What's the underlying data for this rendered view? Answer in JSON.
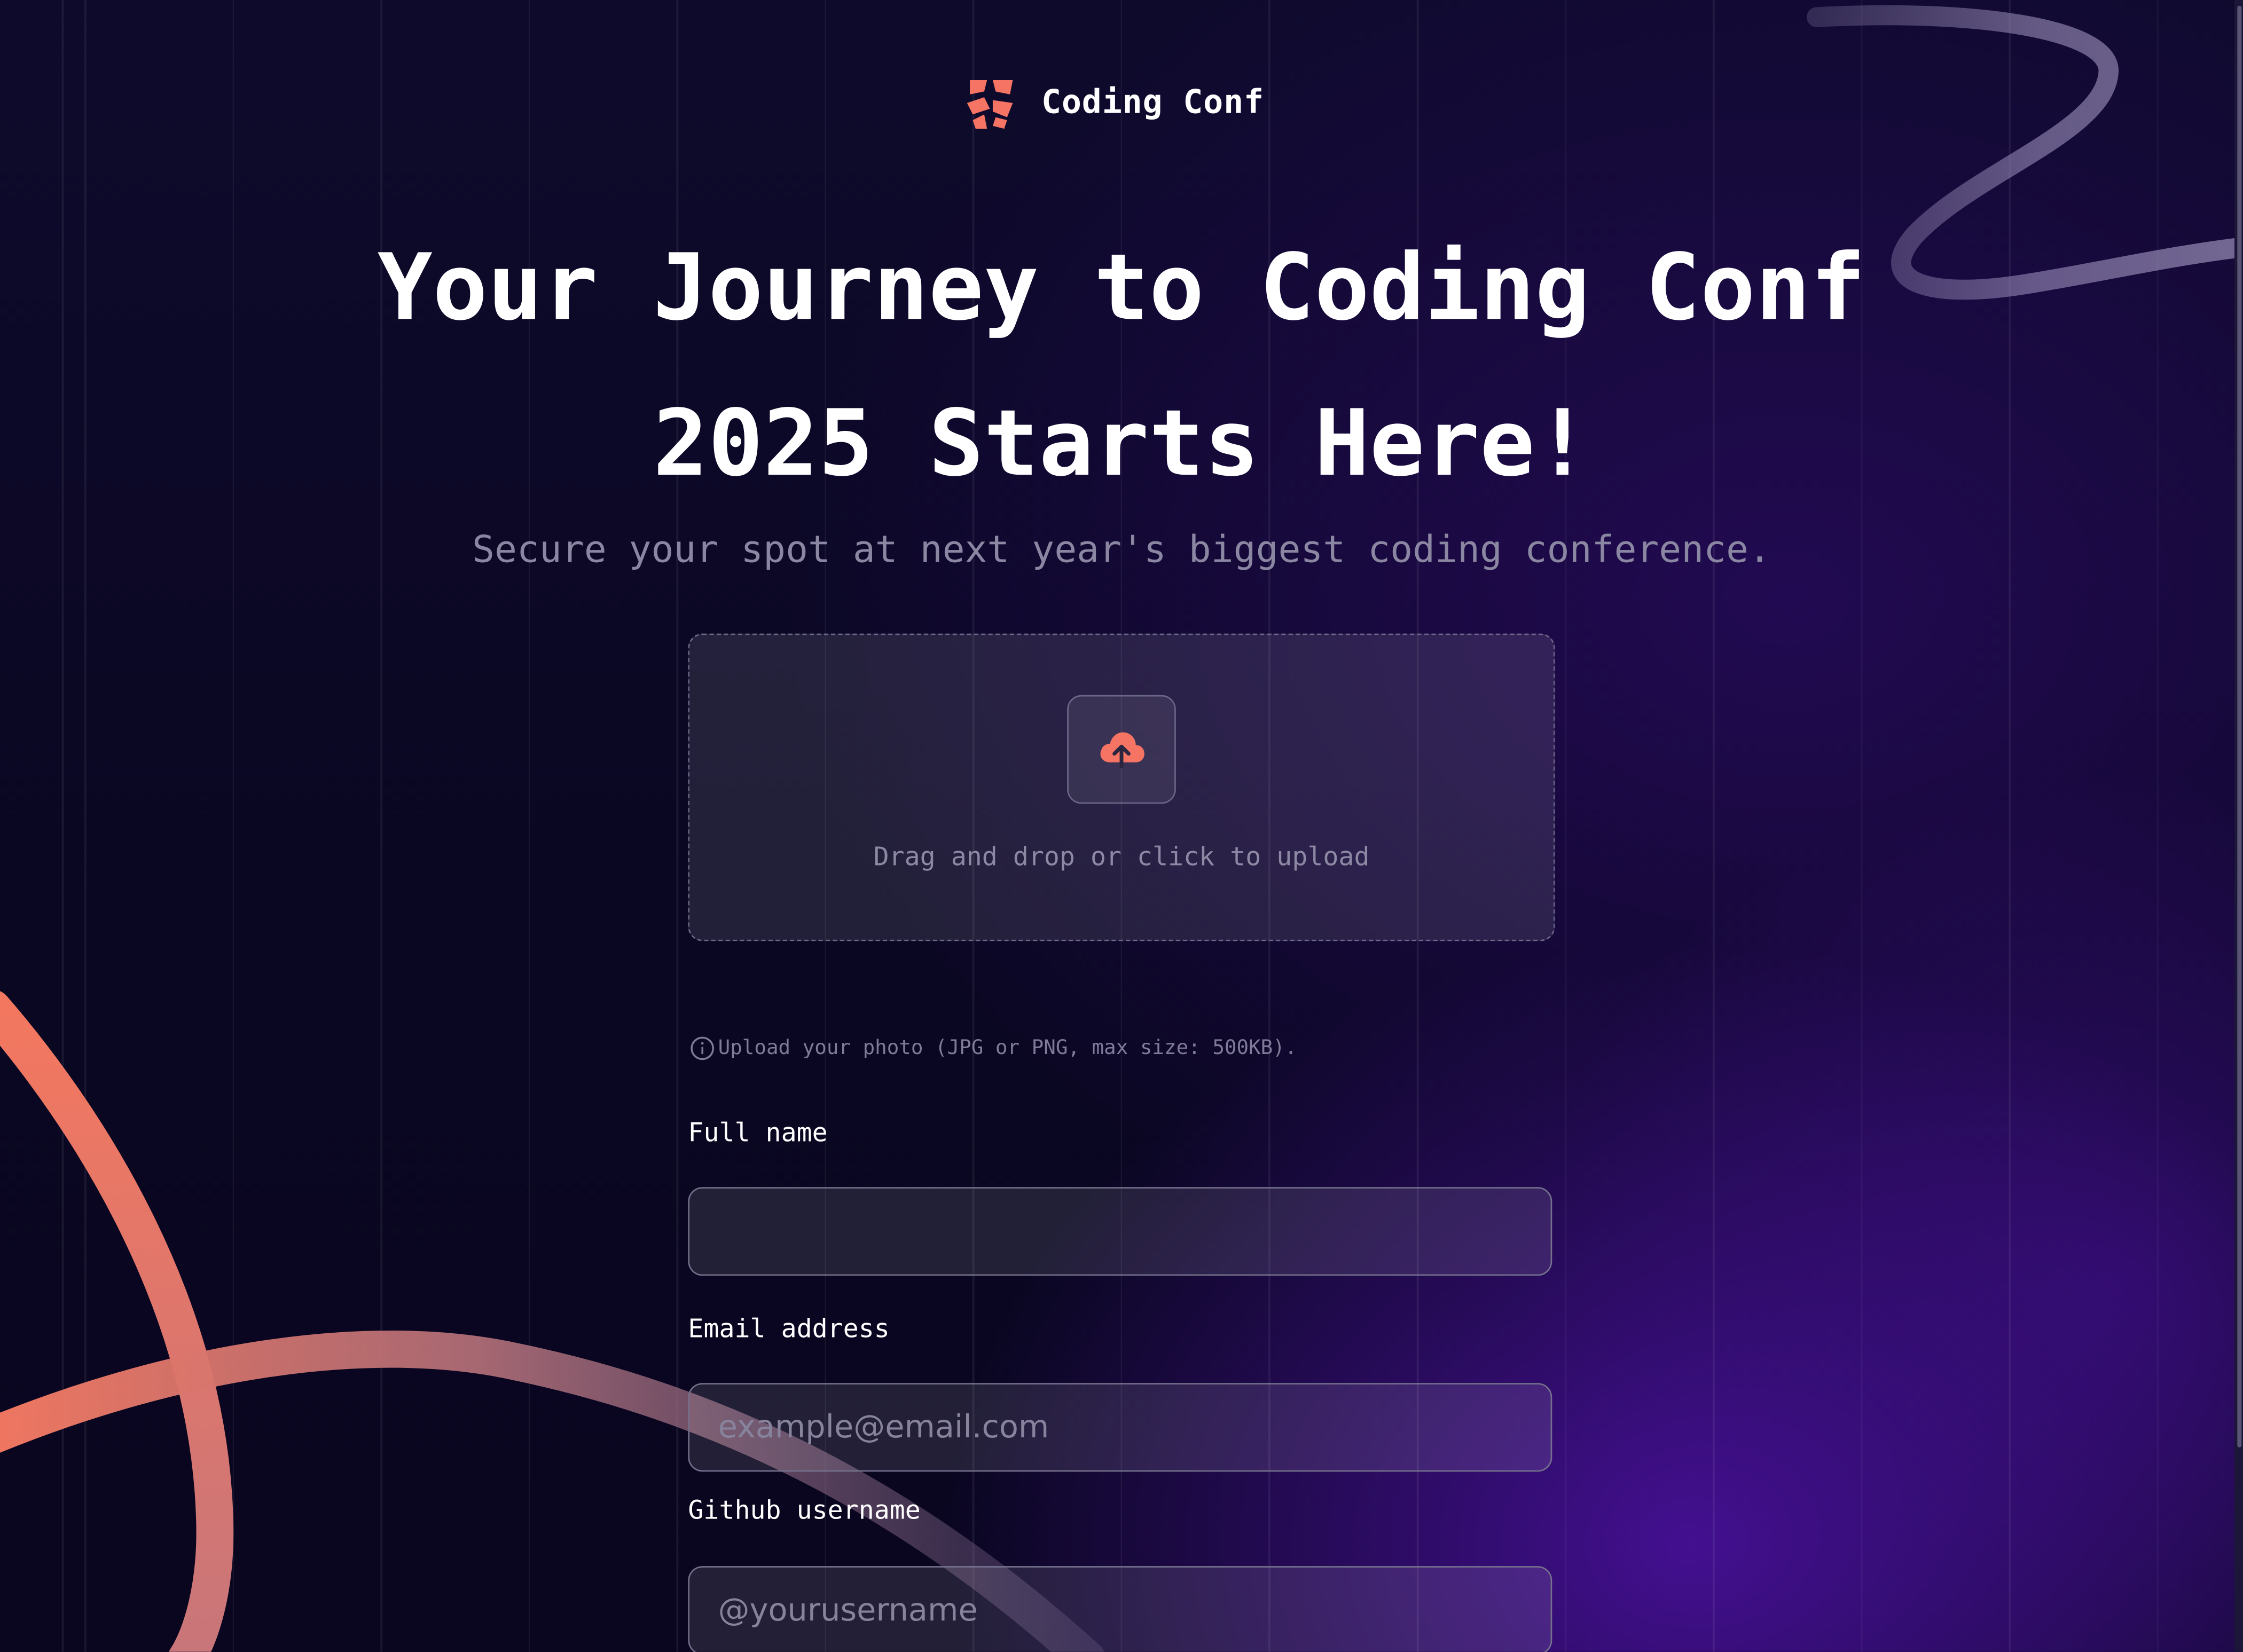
{
  "brand": {
    "name": "Coding Conf"
  },
  "hero": {
    "title": "Your Journey to Coding Conf 2025 Starts Here!",
    "subtitle": "Secure your spot at next year's biggest coding conference."
  },
  "upload": {
    "icon": "cloud-upload-icon",
    "instruction": "Drag and drop or click to upload",
    "hint": "Upload your photo (JPG or PNG, max size: 500KB)."
  },
  "form": {
    "full_name": {
      "label": "Full name",
      "value": "",
      "placeholder": ""
    },
    "email": {
      "label": "Email address",
      "value": "",
      "placeholder": "example@email.com"
    },
    "github": {
      "label": "Github username",
      "value": "",
      "placeholder": "@yourusername"
    }
  },
  "colors": {
    "background": "#0b0722",
    "accent": "#f57463",
    "text_primary": "#ffffff",
    "text_muted": "#8b87a3"
  }
}
